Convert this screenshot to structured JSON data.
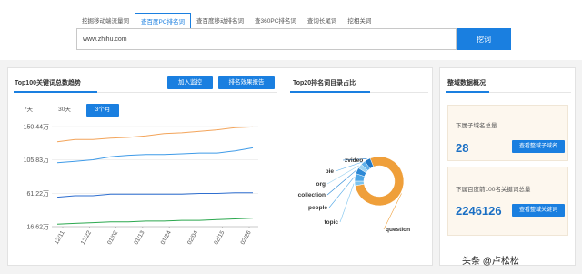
{
  "tabs": [
    {
      "label": "挖掘移动端流量词"
    },
    {
      "label": "查百度PC排名词"
    },
    {
      "label": "查百度移动排名词"
    },
    {
      "label": "查360PC排名词"
    },
    {
      "label": "查询长尾词"
    },
    {
      "label": "挖相关词"
    }
  ],
  "active_tab": 1,
  "search": {
    "value": "www.zhihu.com",
    "button": "挖词"
  },
  "trend": {
    "title": "Top100关键词总数趋势",
    "add_monitor": "加入监控",
    "report_button": "排名效果报告",
    "ranges": [
      "7天",
      "30天",
      "3个月"
    ],
    "active_range": 2
  },
  "pie_section": {
    "title": "Top20排名词目录占比"
  },
  "overview": {
    "title": "整域数据概况",
    "subdomain_label": "下属子域名总量",
    "subdomain_value": "28",
    "subdomain_button": "查看整域子域名",
    "keywords_label": "下属百度前100名关键词总量",
    "keywords_value": "2246126",
    "keywords_button": "查看整域关键词"
  },
  "watermark": "头条 @卢松松",
  "chart_data": [
    {
      "type": "line",
      "title": "Top100关键词总数趋势",
      "y_ticks": [
        "150.44万",
        "105.83万",
        "61.22万",
        "16.62万"
      ],
      "ylim": [
        16.62,
        150.44
      ],
      "x_ticks": [
        "12/11",
        "12/22",
        "01/02",
        "01/13",
        "01/24",
        "02/04",
        "02/15",
        "02/26"
      ],
      "series": [
        {
          "color": "#f3a45a",
          "values": [
            130,
            133,
            133,
            135,
            136,
            138,
            141,
            142,
            144,
            146,
            149,
            150
          ]
        },
        {
          "color": "#3f9be8",
          "values": [
            102,
            104,
            106,
            110,
            112,
            113,
            113,
            114,
            115,
            115,
            118,
            122
          ]
        },
        {
          "color": "#2f6fd0",
          "values": [
            56,
            58,
            58,
            60,
            60,
            60,
            60,
            60,
            61,
            61,
            62,
            62
          ]
        },
        {
          "color": "#2ca84f",
          "values": [
            20,
            21,
            22,
            23,
            23,
            24,
            24,
            25,
            25,
            26,
            27,
            28
          ]
        }
      ]
    },
    {
      "type": "pie",
      "title": "Top20排名词目录占比",
      "slices": [
        {
          "label": "question",
          "color": "#ef9f3a",
          "value": 78
        },
        {
          "label": "topic",
          "color": "#7cc3ee",
          "value": 3
        },
        {
          "label": "people",
          "color": "#4ea6e6",
          "value": 5
        },
        {
          "label": "collection",
          "color": "#2d89d6",
          "value": 4
        },
        {
          "label": "org",
          "color": "#9dd3f2",
          "value": 3
        },
        {
          "label": "pie",
          "color": "#5fb0ea",
          "value": 3
        },
        {
          "label": "zvideo",
          "color": "#1f78c8",
          "value": 4
        }
      ]
    }
  ]
}
